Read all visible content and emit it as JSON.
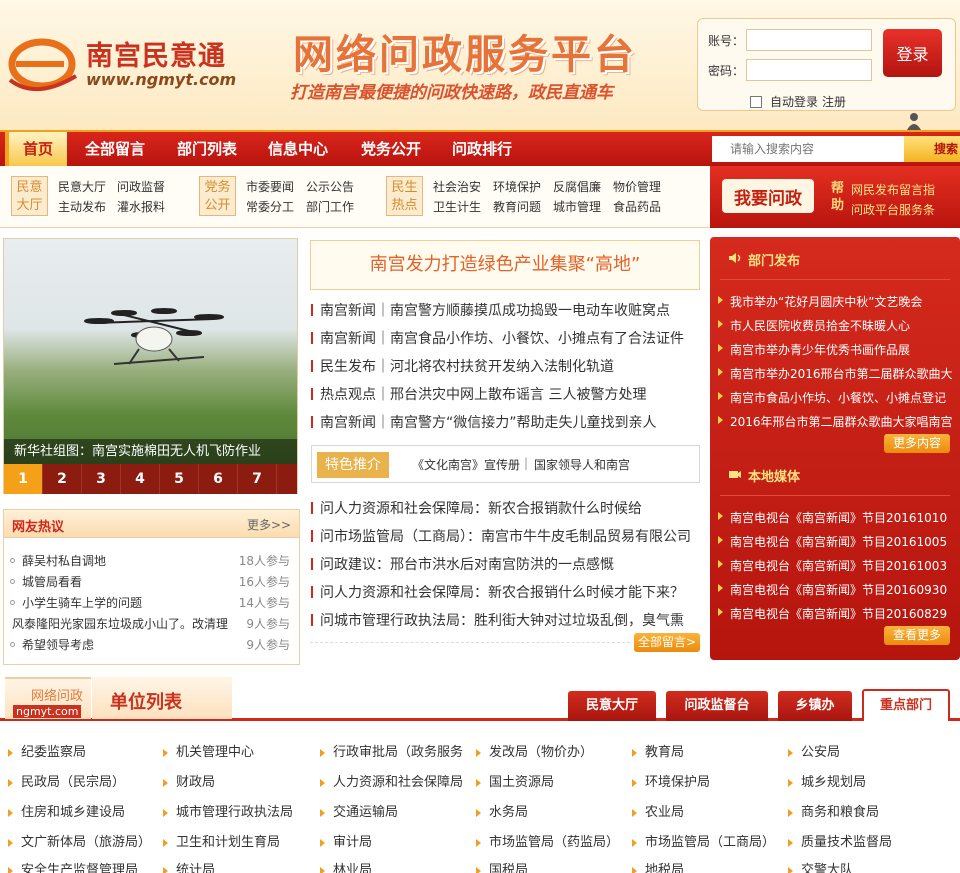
{
  "header": {
    "logo_name": "南宫民意通",
    "logo_url": "www.ngmyt.com",
    "platform_title": "网络问政服务平台",
    "platform_slogan": "打造南宫最便捷的问政快速路，政民直通车"
  },
  "login": {
    "account_label": "账号：",
    "password_label": "密码：",
    "login_button": "登录",
    "auto_login": "自动登录",
    "register": "注册"
  },
  "nav": {
    "items": [
      "首页",
      "全部留言",
      "部门列表",
      "信息中心",
      "党务公开",
      "问政排行"
    ],
    "search_placeholder": "请输入搜索内容",
    "search_button": "搜索"
  },
  "subnav": {
    "groups": [
      {
        "tag": "民意大厅",
        "links": [
          "民意大厅",
          "问政监督",
          "主动发布",
          "灌水报料"
        ]
      },
      {
        "tag": "党务公开",
        "links": [
          "市委要闻",
          "公示公告",
          "常委分工",
          "部门工作"
        ]
      },
      {
        "tag": "民生热点",
        "links": [
          "社会治安",
          "环境保护",
          "反腐倡廉",
          "物价管理",
          "卫生计生",
          "教育问题",
          "城市管理",
          "食品药品"
        ]
      }
    ],
    "want_button": "我要问政",
    "help_label": "帮助",
    "help_links": [
      "网民发布留言指",
      "问政平台服务条"
    ]
  },
  "slider": {
    "caption": "新华社组图：南宫实施棉田无人机飞防作业",
    "tabs": [
      "1",
      "2",
      "3",
      "4",
      "5",
      "6",
      "7"
    ],
    "active_tab": "1"
  },
  "hot": {
    "title": "网友热议",
    "more": "更多>>",
    "items": [
      {
        "title": "薛吴村私自调地",
        "count": "18人参与"
      },
      {
        "title": "城管局看看",
        "count": "16人参与"
      },
      {
        "title": "小学生骑车上学的问题",
        "count": "14人参与"
      },
      {
        "title": "风泰隆阳光家园东垃圾成小山了。改清理",
        "count": "9人参与"
      },
      {
        "title": "希望领导考虑",
        "count": "9人参与"
      }
    ]
  },
  "main": {
    "headline": "南宫发力打造绿色产业集聚“高地”",
    "news": [
      "南宫新闻｜南宫警方顺藤摸瓜成功捣毁一电动车收赃窝点",
      "南宫新闻｜南宫食品小作坊、小餐饮、小摊点有了合法证件",
      "民生发布｜河北将农村扶贫开发纳入法制化轨道",
      "热点观点｜邢台洪灾中网上散布谣言 三人被警方处理",
      "南宫新闻｜南宫警方“微信接力”帮助走失儿童找到亲人"
    ],
    "feature_tag": "特色推介",
    "feature_links": [
      "《文化南宫》宣传册",
      "国家领导人和南宫"
    ],
    "feature_sep": "|",
    "questions": [
      "问人力资源和社会保障局：新农合报销款什么时候给",
      "问市场监管局（工商局）：南宫市牛牛皮毛制品贸易有限公司",
      "问政建议：邢台市洪水后对南宫防洪的一点感慨",
      "问人力资源和社会保障局：新农合报销什么时候才能下来？",
      "问城市管理行政执法局：胜利街大钟对过垃圾乱倒，臭气熏"
    ],
    "all_messages_button": "全部留言>"
  },
  "right": {
    "dept_title": "部门发布",
    "dept_items": [
      "我市举办“花好月圆庆中秋”文艺晚会",
      "市人民医院收费员拾金不昧暖人心",
      "南宫市举办青少年优秀书画作品展",
      "南宫市举办2016邢台市第二届群众歌曲大",
      "南宫市食品小作坊、小餐饮、小摊点登记",
      "2016年邢台市第二届群众歌曲大家唱南宫"
    ],
    "dept_more": "更多内容",
    "media_title": "本地媒体",
    "media_items": [
      "南宫电视台《南宫新闻》节目20161010",
      "南宫电视台《南宫新闻》节目20161005",
      "南宫电视台《南宫新闻》节目20161003",
      "南宫电视台《南宫新闻》节目20160930",
      "南宫电视台《南宫新闻》节目20160829"
    ],
    "media_more": "查看更多"
  },
  "units": {
    "logo_top": "网络问政",
    "logo_bottom": "ngmyt.com",
    "title": "单位列表",
    "tabs": [
      "民意大厅",
      "问政监督台",
      "乡镇办",
      "重点部门"
    ],
    "active_tab": "重点部门",
    "rows": [
      [
        "纪委监察局",
        "机关管理中心",
        "行政审批局（政务服务",
        "发改局（物价办）",
        "教育局",
        "公安局"
      ],
      [
        "民政局（民宗局）",
        "财政局",
        "人力资源和社会保障局",
        "国土资源局",
        "环境保护局",
        "城乡规划局"
      ],
      [
        "住房和城乡建设局",
        "城市管理行政执法局",
        "交通运输局",
        "水务局",
        "农业局",
        "商务和粮食局"
      ],
      [
        "文广新体局（旅游局）",
        "卫生和计划生育局",
        "审计局",
        "市场监管局（药监局）",
        "市场监管局（工商局）",
        "质量技术监督局"
      ],
      [
        "安全生产监督管理局",
        "统计局",
        "林业局",
        "国税局",
        "地税局",
        "交警大队"
      ]
    ]
  },
  "colors": {
    "brand_red": "#d0281a",
    "accent_orange": "#f4a018",
    "headline_orange": "#e3622a"
  }
}
